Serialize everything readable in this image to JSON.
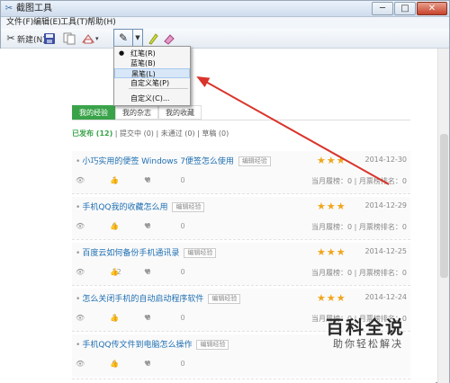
{
  "window": {
    "title": "截图工具",
    "controls": {
      "minimize": "─",
      "maximize": "□",
      "close": "✕"
    }
  },
  "menubar": [
    "文件(F)",
    "编辑(E)",
    "工具(T)",
    "帮助(H)"
  ],
  "toolbar": {
    "new_label": "新建(N)",
    "icons": [
      "scissors-icon",
      "save-icon",
      "copy-icon",
      "send-icon",
      "pen-icon",
      "highlighter-icon",
      "eraser-icon"
    ]
  },
  "pen_menu": {
    "items": [
      "红笔(R)",
      "蓝笔(B)",
      "黑笔(L)",
      "自定义笔(P)",
      "自定义(C)..."
    ],
    "checked_index": 0,
    "highlighted_index": 2
  },
  "tabs": [
    "我的经验",
    "我的杂志",
    "我的收藏"
  ],
  "filters": {
    "published": "已发布 (12)",
    "reviewing": "提交中 (0)",
    "rejected": "未通过 (0)",
    "draft": "草稿 (0)",
    "sep": "|"
  },
  "items": [
    {
      "title": "小巧实用的便签 Windows 7便签怎么使用",
      "tag": "编辑经验",
      "stars": "★★★",
      "date": "2014-12-30",
      "views": "1",
      "likes": "0",
      "favs": "0",
      "rank": "当月履榜：0 | 月票榜排名：0"
    },
    {
      "title": "手机QQ我的收藏怎么用",
      "tag": "编辑经验",
      "stars": "★★★",
      "date": "2014-12-29",
      "views": "0",
      "likes": "0",
      "favs": "0",
      "rank": "当月履榜：0 | 月票榜排名：0"
    },
    {
      "title": "百度云如何备份手机通讯录",
      "tag": "编辑经验",
      "stars": "★★★",
      "date": "2014-12-25",
      "views": "12",
      "likes": "0",
      "favs": "0",
      "rank": "当月履榜：0 | 月票榜排名：0"
    },
    {
      "title": "怎么关闭手机的自动启动程序软件",
      "tag": "编辑经验",
      "stars": "★★★",
      "date": "2014-12-24",
      "views": "7",
      "likes": "0",
      "favs": "0",
      "rank": "当月履榜：0 | 月票榜排名：0"
    },
    {
      "title": "手机QQ传文件到电脑怎么操作",
      "tag": "编辑经验",
      "stars": "",
      "date": "",
      "views": "0",
      "likes": "0",
      "favs": "0",
      "rank": ""
    }
  ],
  "watermark": {
    "main": "百科全说",
    "sub": "助你轻松解决"
  },
  "colors": {
    "accent_green": "#3aa34a",
    "annotation_red": "#d9342b",
    "star": "#f1a51a",
    "link": "#1f6fb2"
  }
}
